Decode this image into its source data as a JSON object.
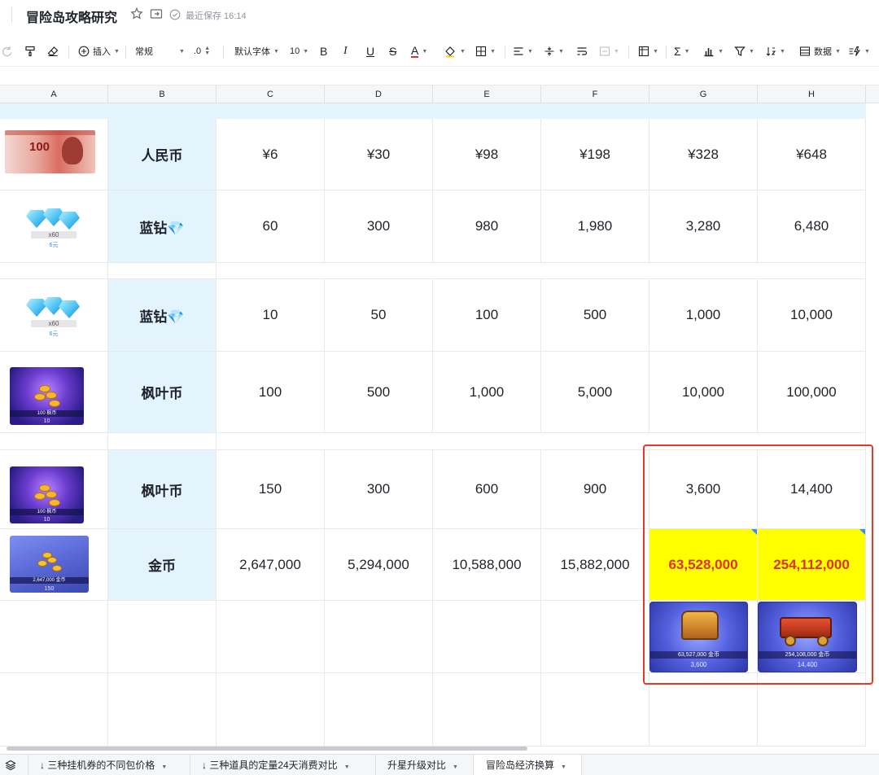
{
  "app": {
    "doc_title": "冒险岛攻略研究",
    "save_status": "最近保存 16:14",
    "star_icon": "star-icon",
    "move_icon": "move-to-icon"
  },
  "toolbar": {
    "insert_label": "插入",
    "format_label": "常规",
    "decimal_label": ".0",
    "font_label": "默认字体",
    "font_size": "10",
    "bold": "B",
    "italic": "I",
    "underline": "U",
    "strike": "S",
    "text_color": "A",
    "data_label": "数据",
    "text_color_hex": "#e0302b"
  },
  "columns": [
    "A",
    "B",
    "C",
    "D",
    "E",
    "F",
    "G",
    "H"
  ],
  "rows": [
    {
      "label": "人民币",
      "image": "rmb-banknote",
      "values": [
        "¥6",
        "¥30",
        "¥98",
        "¥198",
        "¥328",
        "¥648"
      ]
    },
    {
      "label": "蓝钻💎",
      "image": "blue-diamond",
      "image_qty": "x60",
      "image_price": "6元",
      "values": [
        "60",
        "300",
        "980",
        "1,980",
        "3,280",
        "6,480"
      ]
    },
    {
      "label": "蓝钻💎",
      "image": "blue-diamond",
      "image_qty": "x60",
      "image_price": "6元",
      "values": [
        "10",
        "50",
        "100",
        "500",
        "1,000",
        "10,000"
      ]
    },
    {
      "label": "枫叶币",
      "image": "maple-coin",
      "image_caption": "100 枫币",
      "image_sub": "10",
      "values": [
        "100",
        "500",
        "1,000",
        "5,000",
        "10,000",
        "100,000"
      ]
    },
    {
      "label": "枫叶币",
      "image": "maple-coin",
      "image_caption": "100 枫币",
      "image_sub": "10",
      "values": [
        "150",
        "300",
        "600",
        "900",
        "3,600",
        "14,400"
      ]
    },
    {
      "label": "金币",
      "image": "gold-coin",
      "image_caption": "2,647,000 金币",
      "image_sub": "150",
      "values": [
        "2,647,000",
        "5,294,000",
        "10,588,000",
        "15,882,000",
        "63,528,000",
        "254,112,000"
      ]
    }
  ],
  "reward_images": [
    {
      "name": "treasure-chest",
      "caption": "63,527,000 金币",
      "sub": "3,600"
    },
    {
      "name": "gold-cart",
      "caption": "254,108,000 金币",
      "sub": "14,400"
    }
  ],
  "highlight": {
    "fill": "#ffff00",
    "text_color": "#e0302b",
    "frame_color": "#e53a2b"
  },
  "label_fill": "#e3f4fd",
  "sheet_tabs": [
    {
      "label": "↓ 三种挂机券的不同包价格",
      "active": false
    },
    {
      "label": "↓ 三种道具的定量24天消费对比",
      "active": false
    },
    {
      "label": "升星升级对比",
      "active": false
    },
    {
      "label": "冒险岛经济换算",
      "active": true
    }
  ]
}
